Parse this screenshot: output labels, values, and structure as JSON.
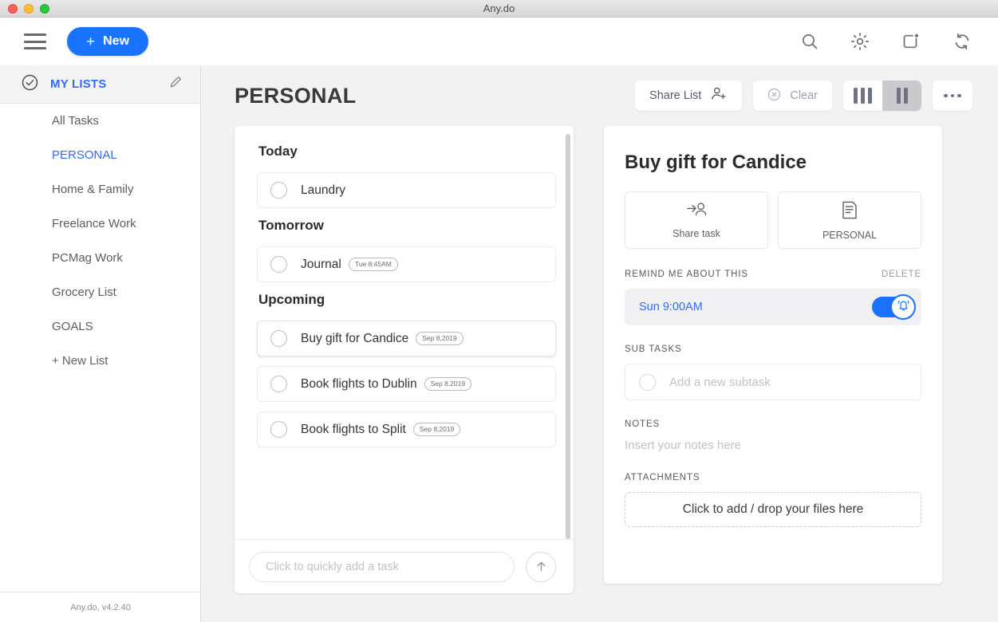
{
  "window": {
    "title": "Any.do",
    "traffic_lights": [
      "close",
      "minimize",
      "maximize"
    ]
  },
  "toolbar": {
    "menu_icon": "hamburger-menu-icon",
    "new_button_label": "New",
    "new_button_plus": "+",
    "accent_color": "#1a73ff",
    "icons": [
      {
        "name": "search-icon",
        "label": "Search"
      },
      {
        "name": "gear-icon",
        "label": "Settings"
      },
      {
        "name": "notifications-icon",
        "label": "Notifications"
      },
      {
        "name": "sync-icon",
        "label": "Sync"
      }
    ]
  },
  "sidebar": {
    "header": {
      "icon": "check-circle-icon",
      "label": "MY LISTS",
      "edit_icon": "pencil-icon",
      "color": "#2f6bff"
    },
    "items": [
      {
        "label": "All Tasks",
        "active": false
      },
      {
        "label": "PERSONAL",
        "active": true
      },
      {
        "label": "Home & Family",
        "active": false
      },
      {
        "label": "Freelance Work",
        "active": false
      },
      {
        "label": "PCMag Work",
        "active": false
      },
      {
        "label": "Grocery List",
        "active": false
      },
      {
        "label": "GOALS",
        "active": false
      },
      {
        "label": "+ New List",
        "active": false
      }
    ],
    "footer": "Any.do, v4.2.40"
  },
  "main": {
    "page_title": "PERSONAL",
    "actions": {
      "share_list_label": "Share List",
      "share_list_icon": "share-person-icon",
      "clear_label": "Clear",
      "clear_icon": "circle-x-icon",
      "view_three_column": "three-column-view",
      "view_two_column": "two-column-view",
      "active_view": "two-column-view",
      "more_label": "More options"
    },
    "sections": [
      {
        "title": "Today",
        "tasks": [
          {
            "label": "Laundry",
            "badge": "",
            "selected": false
          }
        ]
      },
      {
        "title": "Tomorrow",
        "tasks": [
          {
            "label": "Journal",
            "badge": "Tue 8:45AM",
            "selected": false
          }
        ]
      },
      {
        "title": "Upcoming",
        "tasks": [
          {
            "label": "Buy gift for Candice",
            "badge": "Sep 8,2019",
            "selected": true
          },
          {
            "label": "Book flights to Dublin",
            "badge": "Sep 8,2019",
            "selected": false
          },
          {
            "label": "Book flights to Split",
            "badge": "Sep 8,2019",
            "selected": false
          }
        ]
      }
    ],
    "quick_add": {
      "placeholder": "Click to quickly add a task",
      "value": "",
      "send_icon": "arrow-up-icon"
    }
  },
  "detail": {
    "title": "Buy gift for Candice",
    "cards": [
      {
        "label": "Share task",
        "icon": "share-person-icon"
      },
      {
        "label": "PERSONAL",
        "icon": "list-document-icon"
      }
    ],
    "reminder": {
      "heading": "REMIND ME ABOUT THIS",
      "delete_label": "DELETE",
      "time": "Sun 9:00AM",
      "toggle_on": true,
      "toggle_icon": "bell-icon",
      "time_color": "#2f6bff"
    },
    "subtasks": {
      "heading": "SUB TASKS",
      "placeholder": "Add a new subtask",
      "value": ""
    },
    "notes": {
      "heading": "NOTES",
      "placeholder": "Insert your notes here",
      "value": ""
    },
    "attachments": {
      "heading": "ATTACHMENTS",
      "drop_label": "Click to add / drop your files here"
    }
  }
}
